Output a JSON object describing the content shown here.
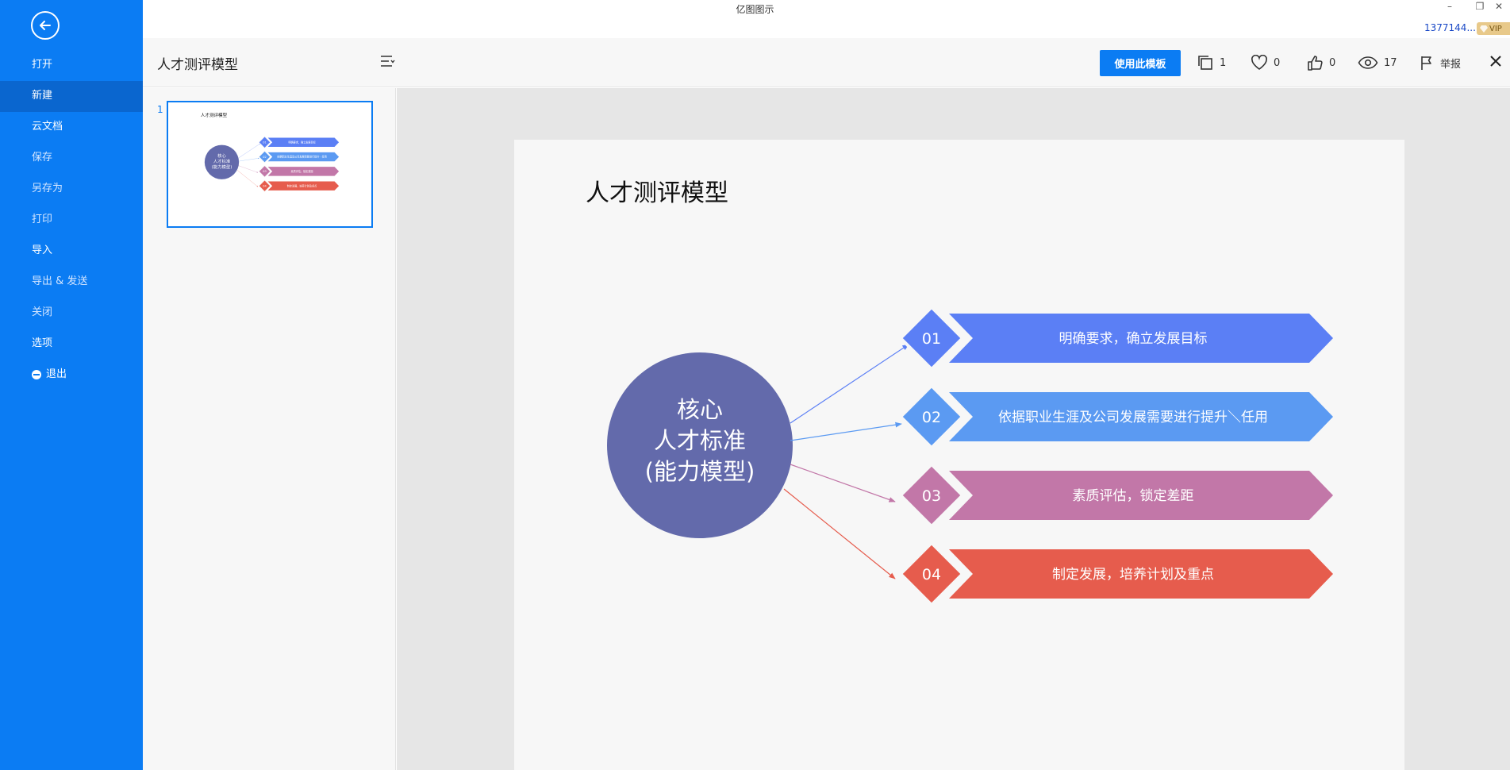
{
  "window": {
    "title": "亿图图示",
    "minimize": "–",
    "restore": "❐",
    "close": "✕"
  },
  "user": {
    "name": "1377144...",
    "badge": "VIP"
  },
  "sidebar": {
    "items": [
      {
        "label": "打开",
        "state": "normal"
      },
      {
        "label": "新建",
        "state": "active"
      },
      {
        "label": "云文档",
        "state": "normal"
      },
      {
        "label": "保存",
        "state": "dim"
      },
      {
        "label": "另存为",
        "state": "dim"
      },
      {
        "label": "打印",
        "state": "dim"
      },
      {
        "label": "导入",
        "state": "normal"
      },
      {
        "label": "导出 & 发送",
        "state": "dim"
      },
      {
        "label": "关闭",
        "state": "dim"
      },
      {
        "label": "选项",
        "state": "normal"
      },
      {
        "label": "退出",
        "state": "normal"
      }
    ]
  },
  "header": {
    "title": "人才测评模型",
    "use_template": "使用此模板",
    "copies": "1",
    "favorites": "0",
    "likes": "0",
    "views": "17",
    "report": "举报"
  },
  "thumbnails": {
    "page_number": "1"
  },
  "diagram": {
    "title": "人才测评模型",
    "center_lines": [
      "核心",
      "人才标准",
      "(能力模型)"
    ],
    "center_color": "#636aab",
    "items": [
      {
        "num": "01",
        "text": "明确要求，确立发展目标",
        "color": "#5b7ff5"
      },
      {
        "num": "02",
        "text": "依据职业生涯及公司发展需要进行提升＼任用",
        "color": "#5b9af2"
      },
      {
        "num": "03",
        "text": "素质评估，锁定差距",
        "color": "#c277a8"
      },
      {
        "num": "04",
        "text": "制定发展，培养计划及重点",
        "color": "#e65c4d"
      }
    ]
  },
  "colors": {
    "accent": "#0b7cf3",
    "sidebar": "#0b7cf3",
    "sidebar_active": "#0a66cf"
  }
}
